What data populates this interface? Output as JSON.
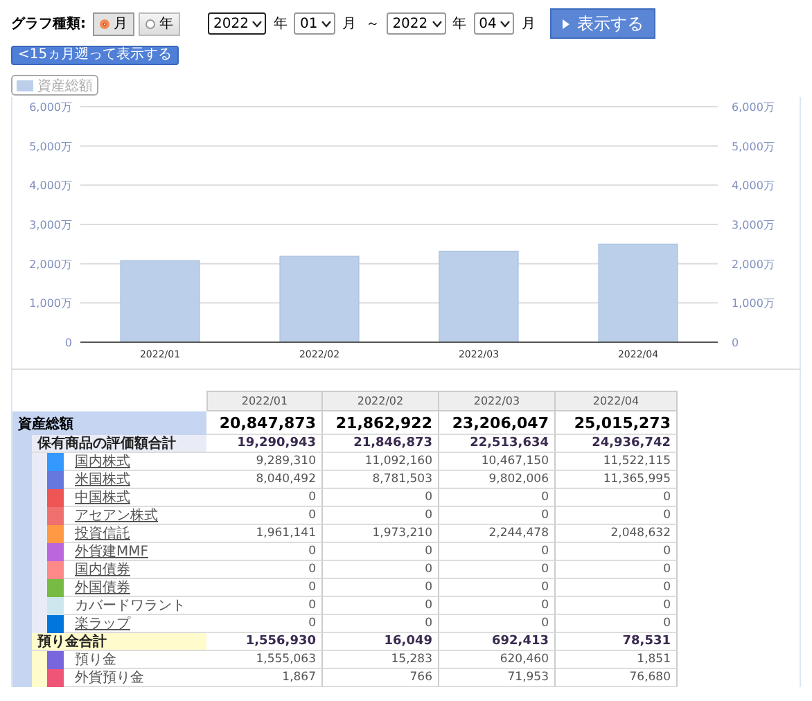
{
  "controls": {
    "graph_type_label": "グラフ種類:",
    "graph_types": [
      {
        "label": "月",
        "selected": true
      },
      {
        "label": "年",
        "selected": false
      }
    ],
    "from_year": "2022",
    "from_year_unit": "年",
    "from_month": "01",
    "from_month_unit": "月",
    "range_sep": "～",
    "to_year": "2022",
    "to_year_unit": "年",
    "to_month": "04",
    "to_month_unit": "月",
    "show_button": "表示する",
    "back_button": "<15ヵ月遡って表示する"
  },
  "chart_data": {
    "type": "bar",
    "grid": true,
    "categories": [
      "2022/01",
      "2022/02",
      "2022/03",
      "2022/04"
    ],
    "series": [
      {
        "name": "資産総額",
        "color": "#bccfea",
        "values": [
          2080,
          2190,
          2320,
          2500
        ]
      }
    ],
    "ylim": [
      0,
      6000
    ],
    "yticks": [
      {
        "value": 0,
        "label": "0"
      },
      {
        "value": 1000,
        "label": "1,000万"
      },
      {
        "value": 2000,
        "label": "2,000万"
      },
      {
        "value": 3000,
        "label": "3,000万"
      },
      {
        "value": 4000,
        "label": "4,000万"
      },
      {
        "value": 5000,
        "label": "5,000万"
      },
      {
        "value": 6000,
        "label": "6,000万"
      }
    ]
  },
  "table": {
    "columns": [
      "2022/01",
      "2022/02",
      "2022/03",
      "2022/04"
    ],
    "rows": [
      {
        "label": "資産総額",
        "values": [
          "20,847,873",
          "21,862,922",
          "23,206,047",
          "25,015,273"
        ],
        "children": [
          {
            "label": "保有商品の評価額合計",
            "color": "#e9ecf7",
            "values": [
              "19,290,943",
              "21,846,873",
              "22,513,634",
              "24,936,742"
            ],
            "children": [
              {
                "label": "国内株式",
                "color": "#3399ff",
                "link": true,
                "values": [
                  "9,289,310",
                  "11,092,160",
                  "10,467,150",
                  "11,522,115"
                ]
              },
              {
                "label": "米国株式",
                "color": "#6677dd",
                "link": true,
                "values": [
                  "8,040,492",
                  "8,781,503",
                  "9,802,006",
                  "11,365,995"
                ]
              },
              {
                "label": "中国株式",
                "color": "#ee5555",
                "link": true,
                "values": [
                  "0",
                  "0",
                  "0",
                  "0"
                ]
              },
              {
                "label": "アセアン株式",
                "color": "#f07070",
                "link": true,
                "values": [
                  "0",
                  "0",
                  "0",
                  "0"
                ]
              },
              {
                "label": "投資信託",
                "color": "#ff9944",
                "link": true,
                "values": [
                  "1,961,141",
                  "1,973,210",
                  "2,244,478",
                  "2,048,632"
                ]
              },
              {
                "label": "外貨建MMF",
                "color": "#bb66dd",
                "link": true,
                "values": [
                  "0",
                  "0",
                  "0",
                  "0"
                ]
              },
              {
                "label": "国内債券",
                "color": "#ff8888",
                "link": true,
                "values": [
                  "0",
                  "0",
                  "0",
                  "0"
                ]
              },
              {
                "label": "外国債券",
                "color": "#77bb44",
                "link": true,
                "values": [
                  "0",
                  "0",
                  "0",
                  "0"
                ]
              },
              {
                "label": "カバードワラント",
                "color": "#cce8ee",
                "link": false,
                "values": [
                  "0",
                  "0",
                  "0",
                  "0"
                ]
              },
              {
                "label": "楽ラップ",
                "color": "#0077dd",
                "link": true,
                "values": [
                  "0",
                  "0",
                  "0",
                  "0"
                ]
              }
            ]
          },
          {
            "label": "預り金合計",
            "color": "#fffbcc",
            "values": [
              "1,556,930",
              "16,049",
              "692,413",
              "78,531"
            ],
            "children": [
              {
                "label": "預り金",
                "color": "#7766dd",
                "link": false,
                "values": [
                  "1,555,063",
                  "15,283",
                  "620,460",
                  "1,851"
                ]
              },
              {
                "label": "外貨預り金",
                "color": "#ee5577",
                "link": false,
                "values": [
                  "1,867",
                  "766",
                  "71,953",
                  "76,680"
                ]
              }
            ]
          }
        ]
      }
    ]
  }
}
